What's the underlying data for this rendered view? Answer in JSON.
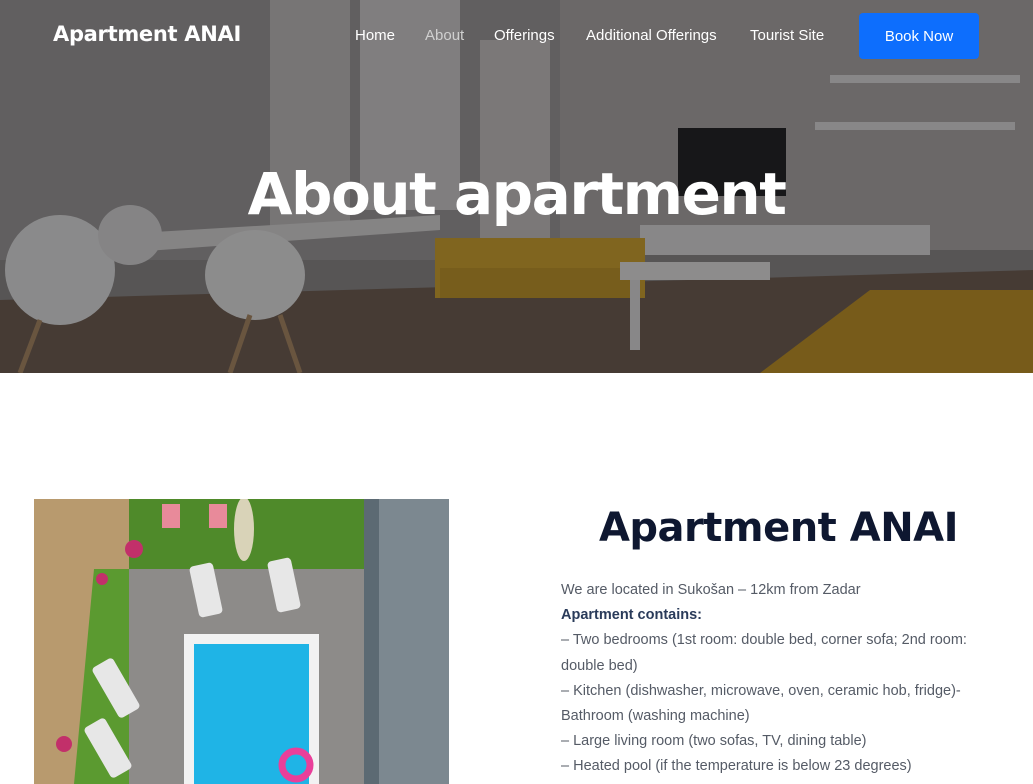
{
  "header": {
    "brand": "Apartment ANAI",
    "nav": [
      {
        "label": "Home",
        "active": false
      },
      {
        "label": "About",
        "active": true
      },
      {
        "label": "Offerings",
        "active": false
      },
      {
        "label": "Additional Offerings",
        "active": false
      },
      {
        "label": "Tourist Site",
        "active": false
      }
    ],
    "cta": "Book Now"
  },
  "hero": {
    "title": "About apartment"
  },
  "about": {
    "title": "Apartment ANAI",
    "lines": [
      "We are located in Sukošan – 12km from Zadar",
      "Apartment contains:",
      "– Two bedrooms (1st room: double bed, corner sofa; 2nd room:",
      "double bed)",
      "– Kitchen (dishwasher, microwave, oven, ceramic hob, fridge)-",
      "Bathroom (washing machine)",
      "– Large living room (two sofas, TV, dining table)",
      "– Heated pool (if the temperature is below 23 degrees)"
    ]
  },
  "colors": {
    "accent": "#0d6efd",
    "heading": "#0e1730",
    "body_text": "#555b66"
  }
}
